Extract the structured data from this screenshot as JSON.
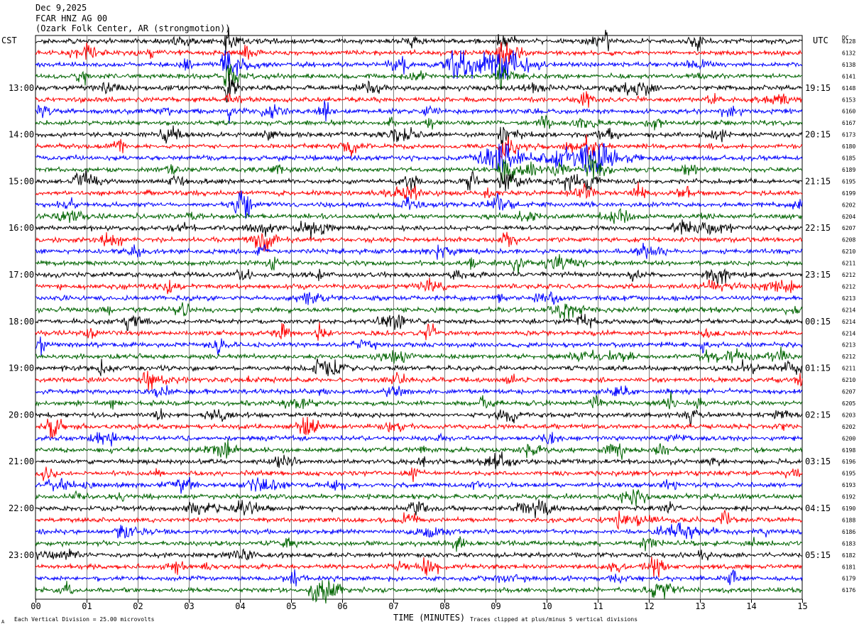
{
  "header": {
    "date": "Dec 9,2025",
    "station": "FCAR HNZ AG 00",
    "location": "(Ozark Folk Center, AR (strongmotion))"
  },
  "left_tz": "CST",
  "right_tz": "UTC",
  "dc_label": "DC",
  "footer": {
    "scale_prefix": "Each Vertical Division =",
    "scale_value": "25.00 microvolts",
    "clip_note": "Traces clipped at plus/minus 5 vertical divisions",
    "corner_mark": "A"
  },
  "colors": {
    "black": "#000000",
    "red": "#ff0000",
    "blue": "#0000ff",
    "green": "#006400",
    "grid": "#808080"
  },
  "chart_data": {
    "type": "line",
    "title": "FCAR HNZ AG 00",
    "xlabel": "TIME (MINUTES)",
    "ylabel": "",
    "xlim": [
      0,
      15
    ],
    "x_ticks": [
      "00",
      "01",
      "02",
      "03",
      "04",
      "05",
      "06",
      "07",
      "08",
      "09",
      "10",
      "11",
      "12",
      "13",
      "14",
      "15"
    ],
    "cst_hour_labels": [
      "13:00",
      "14:00",
      "15:00",
      "16:00",
      "17:00",
      "18:00",
      "19:00",
      "20:00",
      "21:00",
      "22:00",
      "23:00"
    ],
    "utc_hour_labels": [
      "19:15",
      "20:15",
      "21:15",
      "22:15",
      "23:15",
      "00:15",
      "01:15",
      "02:15",
      "03:15",
      "04:15",
      "05:15"
    ],
    "trace_color_cycle": [
      "black",
      "red",
      "blue",
      "green"
    ],
    "dc_offsets": [
      6128,
      6132,
      6138,
      6141,
      6148,
      6153,
      6160,
      6167,
      6173,
      6180,
      6185,
      6189,
      6195,
      6199,
      6202,
      6204,
      6207,
      6208,
      6210,
      6211,
      6212,
      6212,
      6213,
      6214,
      6214,
      6214,
      6213,
      6212,
      6211,
      6210,
      6207,
      6205,
      6203,
      6202,
      6200,
      6198,
      6196,
      6195,
      6193,
      6192,
      6190,
      6188,
      6186,
      6183,
      6182,
      6181,
      6179,
      6176
    ],
    "events": [
      {
        "trace": 2,
        "minute": 3.75,
        "amplitude": 5,
        "duration": 0.35
      },
      {
        "trace": 0,
        "minute": 3.75,
        "amplitude": 4,
        "duration": 0.2
      },
      {
        "trace": 3,
        "minute": 3.75,
        "amplitude": 5,
        "duration": 0.2
      },
      {
        "trace": 4,
        "minute": 3.75,
        "amplitude": 5,
        "duration": 0.2
      },
      {
        "trace": 5,
        "minute": 3.75,
        "amplitude": 4,
        "duration": 0.15
      },
      {
        "trace": 6,
        "minute": 3.75,
        "amplitude": 3,
        "duration": 0.15
      },
      {
        "trace": 2,
        "minute": 8.3,
        "amplitude": 3,
        "duration": 0.9
      },
      {
        "trace": 2,
        "minute": 9.1,
        "amplitude": 5,
        "duration": 0.5
      },
      {
        "trace": 1,
        "minute": 9.1,
        "amplitude": 5,
        "duration": 0.3
      },
      {
        "trace": 3,
        "minute": 9.1,
        "amplitude": 4,
        "duration": 0.3
      },
      {
        "trace": 0,
        "minute": 9.1,
        "amplitude": 4,
        "duration": 0.2
      },
      {
        "trace": 8,
        "minute": 9.15,
        "amplitude": 4,
        "duration": 0.3
      },
      {
        "trace": 9,
        "minute": 9.15,
        "amplitude": 4,
        "duration": 0.3
      },
      {
        "trace": 10,
        "minute": 9.1,
        "amplitude": 5,
        "duration": 0.5
      },
      {
        "trace": 11,
        "minute": 9.15,
        "amplitude": 5,
        "duration": 0.3
      },
      {
        "trace": 12,
        "minute": 9.15,
        "amplitude": 3,
        "duration": 0.3
      },
      {
        "trace": 10,
        "minute": 10.8,
        "amplitude": 5,
        "duration": 0.5
      },
      {
        "trace": 9,
        "minute": 10.8,
        "amplitude": 4,
        "duration": 0.2
      },
      {
        "trace": 11,
        "minute": 10.8,
        "amplitude": 4,
        "duration": 0.2
      },
      {
        "trace": 12,
        "minute": 10.8,
        "amplitude": 3,
        "duration": 0.2
      },
      {
        "trace": 10,
        "minute": 10.2,
        "amplitude": 1.5,
        "duration": 1.0
      },
      {
        "trace": 16,
        "minute": 12.6,
        "amplitude": 2,
        "duration": 0.5
      },
      {
        "trace": 29,
        "minute": 2.2,
        "amplitude": 1.8,
        "duration": 0.4
      },
      {
        "trace": 38,
        "minute": 0.4,
        "amplitude": 1.5,
        "duration": 0.6
      },
      {
        "trace": 42,
        "minute": 1.7,
        "amplitude": 1.5,
        "duration": 0.5
      },
      {
        "trace": 42,
        "minute": 12.3,
        "amplitude": 2,
        "duration": 0.7
      },
      {
        "trace": 41,
        "minute": 11.8,
        "amplitude": 1.5,
        "duration": 0.4
      },
      {
        "trace": 43,
        "minute": 11.9,
        "amplitude": 1.5,
        "duration": 0.3
      },
      {
        "trace": 46,
        "minute": 11.3,
        "amplitude": 1.5,
        "duration": 0.3
      },
      {
        "trace": 45,
        "minute": 11.3,
        "amplitude": 1.5,
        "duration": 0.3
      },
      {
        "trace": 47,
        "minute": 5.5,
        "amplitude": 1.3,
        "duration": 0.3
      },
      {
        "trace": 23,
        "minute": 14.8,
        "amplitude": 1.3,
        "duration": 0.4
      },
      {
        "trace": 6,
        "minute": 13.5,
        "amplitude": 1.2,
        "duration": 0.4
      },
      {
        "trace": 21,
        "minute": 13.2,
        "amplitude": 1.2,
        "duration": 0.6
      }
    ]
  }
}
